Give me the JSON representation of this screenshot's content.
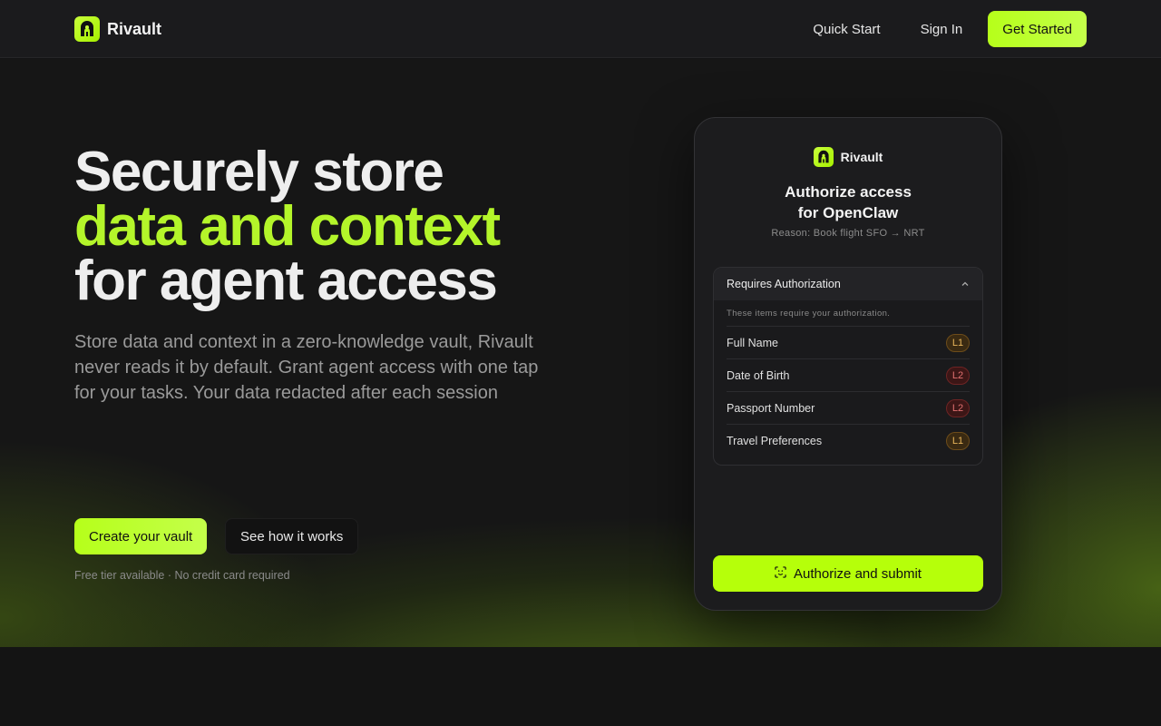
{
  "header": {
    "brand": "Rivault",
    "nav": [
      "Quick Start",
      "Sign In"
    ],
    "cta": "Get Started"
  },
  "hero": {
    "headline_line1": "Securely store",
    "headline_line2": "data and context",
    "headline_line3": "for agent access",
    "subtext": "Store data and context in a zero-knowledge vault, Rivault never reads it by default. Grant agent access with one tap for your tasks. Your data redacted after each session",
    "primary_button": "Create your vault",
    "secondary_button": "See how it works",
    "fine_print": "Free tier available · No credit card required"
  },
  "card": {
    "brand": "Rivault",
    "title_line1": "Authorize access",
    "title_line2": "for OpenClaw",
    "reason": "Reason: Book flight SFO → NRT",
    "panel_title": "Requires Authorization",
    "panel_note": "These items require your authorization.",
    "items": [
      {
        "label": "Full Name",
        "level": "L1"
      },
      {
        "label": "Date of Birth",
        "level": "L2"
      },
      {
        "label": "Passport Number",
        "level": "L2"
      },
      {
        "label": "Travel Preferences",
        "level": "L1"
      }
    ],
    "submit": "Authorize and submit"
  },
  "colors": {
    "accent": "#b6ff1a",
    "background": "#141414",
    "level1": "#e6b45a",
    "level2": "#e07070"
  },
  "icons": [
    "rivault-logo-icon",
    "chevron-up-icon",
    "face-scan-icon"
  ]
}
